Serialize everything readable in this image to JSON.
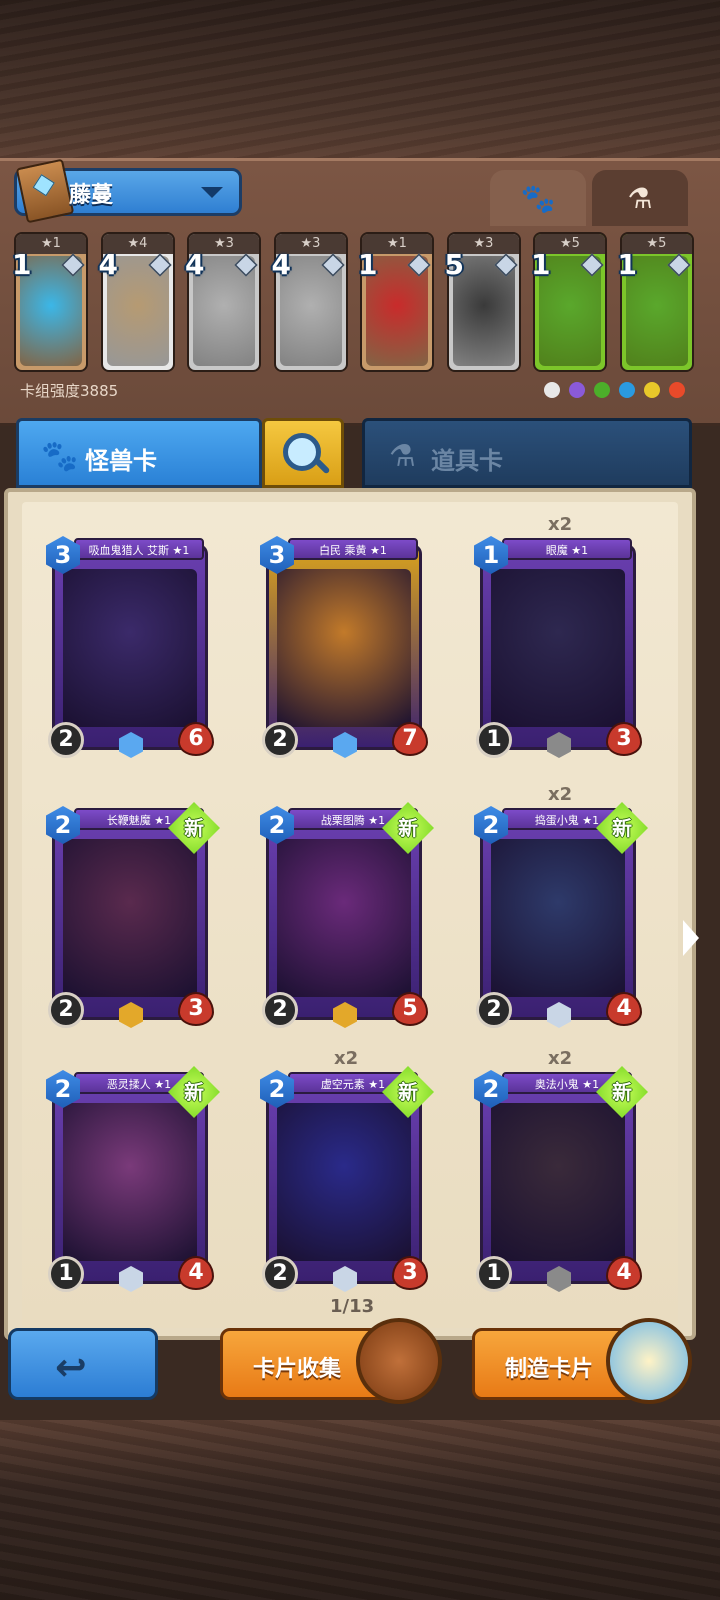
{
  "deck": {
    "name": "藤蔓",
    "power_label": "卡组强度3885"
  },
  "type_tabs": [
    {
      "icon": "paw-icon",
      "active": false
    },
    {
      "icon": "potion-icon",
      "active": true
    }
  ],
  "deck_slots": [
    {
      "stars": "★1",
      "count": "1",
      "art": "egg",
      "color": "#3bb7e8",
      "frame": "#c79a6a"
    },
    {
      "stars": "★4",
      "count": "4",
      "art": "boots",
      "color": "#b69a72",
      "frame": "#e8e8e8"
    },
    {
      "stars": "★3",
      "count": "4",
      "art": "flute",
      "color": "#b0b0b0",
      "frame": "#c8c8c8"
    },
    {
      "stars": "★3",
      "count": "4",
      "art": "flute",
      "color": "#b0b0b0",
      "frame": "#c8c8c8"
    },
    {
      "stars": "★1",
      "count": "1",
      "art": "potion",
      "color": "#c92b2b",
      "frame": "#c79a6a"
    },
    {
      "stars": "★3",
      "count": "5",
      "art": "anubis-staff",
      "color": "#3a3a3a",
      "frame": "#c8c8c8"
    },
    {
      "stars": "★5",
      "count": "1",
      "art": "green-tunic",
      "color": "#5aa82c",
      "frame": "#7cc62a"
    },
    {
      "stars": "★5",
      "count": "1",
      "art": "green-tunic",
      "color": "#5aa82c",
      "frame": "#7cc62a"
    }
  ],
  "element_filters": [
    "neutral",
    "arcane",
    "nature",
    "water",
    "lightning",
    "fire"
  ],
  "categories": {
    "monster_label": "怪兽卡",
    "item_label": "道具卡"
  },
  "cards": [
    {
      "name": "吸血鬼猎人 艾斯 ★1",
      "cost": "3",
      "atk": "2",
      "hp": "6",
      "new": false,
      "dup": "",
      "art_color": "#3b2a6a",
      "frame": "#6a3fb0",
      "gem": "#5aa8f0"
    },
    {
      "name": "白民 乘黄 ★1",
      "cost": "3",
      "atk": "2",
      "hp": "7",
      "new": false,
      "dup": "",
      "art_color": "#c27a2a",
      "frame": "#d8a21e",
      "gem": "#5aa8f0"
    },
    {
      "name": "眼魔 ★1",
      "cost": "1",
      "atk": "1",
      "hp": "3",
      "new": false,
      "dup": "x2",
      "art_color": "#2e2850",
      "frame": "#6a3fb0",
      "gem": "#8a8a8a"
    },
    {
      "name": "长鞭魅魔 ★1",
      "cost": "2",
      "atk": "2",
      "hp": "3",
      "new": true,
      "dup": "",
      "art_color": "#5a2a4e",
      "frame": "#6a3fb0",
      "gem": "#e3a82a"
    },
    {
      "name": "战栗图腾 ★1",
      "cost": "2",
      "atk": "2",
      "hp": "5",
      "new": true,
      "dup": "",
      "art_color": "#6a2a7a",
      "frame": "#6a3fb0",
      "gem": "#e3a82a"
    },
    {
      "name": "捣蛋小鬼 ★1",
      "cost": "2",
      "atk": "2",
      "hp": "4",
      "new": true,
      "dup": "x2",
      "art_color": "#2e3a6a",
      "frame": "#6a3fb0",
      "gem": "#c9d6e6"
    },
    {
      "name": "恶灵揉人 ★1",
      "cost": "2",
      "atk": "1",
      "hp": "4",
      "new": true,
      "dup": "",
      "art_color": "#7a3a7a",
      "frame": "#6a3fb0",
      "gem": "#c9d6e6"
    },
    {
      "name": "虚空元素 ★1",
      "cost": "2",
      "atk": "2",
      "hp": "3",
      "new": true,
      "dup": "x2",
      "art_color": "#2a2a8a",
      "frame": "#6a3fb0",
      "gem": "#c9d6e6"
    },
    {
      "name": "奥法小鬼 ★1",
      "cost": "2",
      "atk": "1",
      "hp": "4",
      "new": true,
      "dup": "x2",
      "art_color": "#3a2a3a",
      "frame": "#6a3fb0",
      "gem": "#8a8a8a"
    }
  ],
  "new_label": "新",
  "pager": "1/13",
  "buttons": {
    "collect": "卡片收集",
    "craft": "制造卡片"
  }
}
